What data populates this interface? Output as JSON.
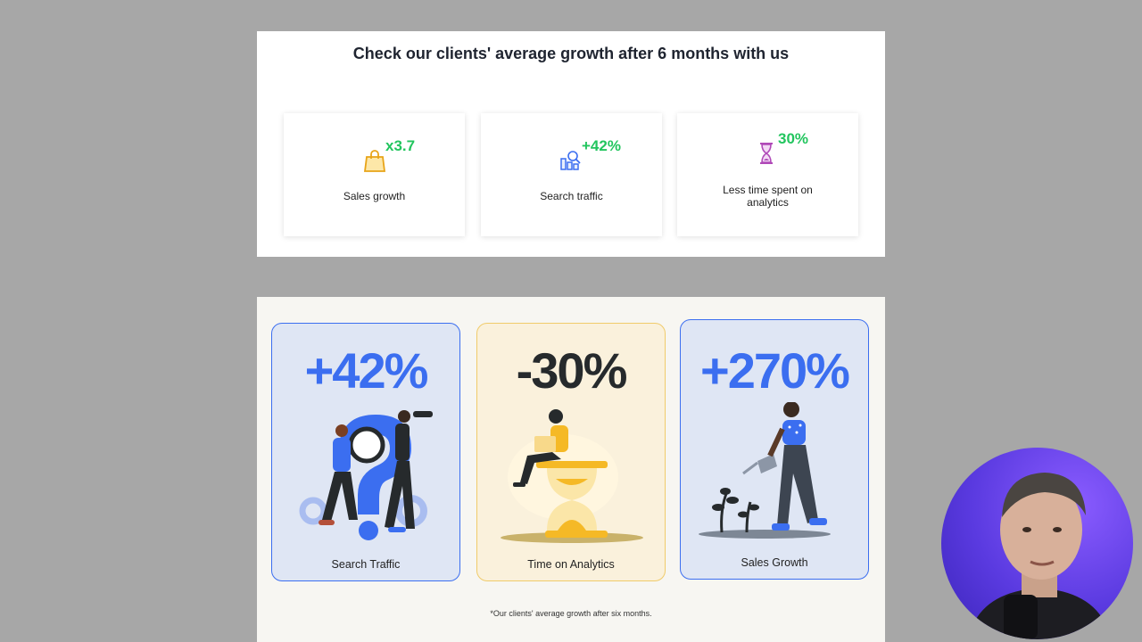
{
  "top_panel": {
    "title": "Check our clients' average growth after 6 months with us",
    "cards": [
      {
        "value": "x3.7",
        "label": "Sales growth",
        "icon": "shopping-bag-icon"
      },
      {
        "value": "+42%",
        "label": "Search traffic",
        "icon": "search-chart-icon"
      },
      {
        "value": "30%",
        "label": "Less time spent on analytics",
        "icon": "hourglass-icon"
      }
    ]
  },
  "bottom_panel": {
    "cards": [
      {
        "value": "+42%",
        "label": "Search Traffic",
        "illustration": "search-traffic-illustration"
      },
      {
        "value": "-30%",
        "label": "Time on Analytics",
        "illustration": "hourglass-person-illustration"
      },
      {
        "value": "+270%",
        "label": "Sales Growth",
        "illustration": "watering-plant-illustration"
      }
    ],
    "footnote": "*Our clients' average growth after six months."
  },
  "colors": {
    "accent_green": "#22c55e",
    "accent_blue": "#3b6ef0",
    "dark_text": "#262a2c",
    "card_blue_bg": "#dfe6f4",
    "card_yellow_bg": "#faf1dc"
  }
}
